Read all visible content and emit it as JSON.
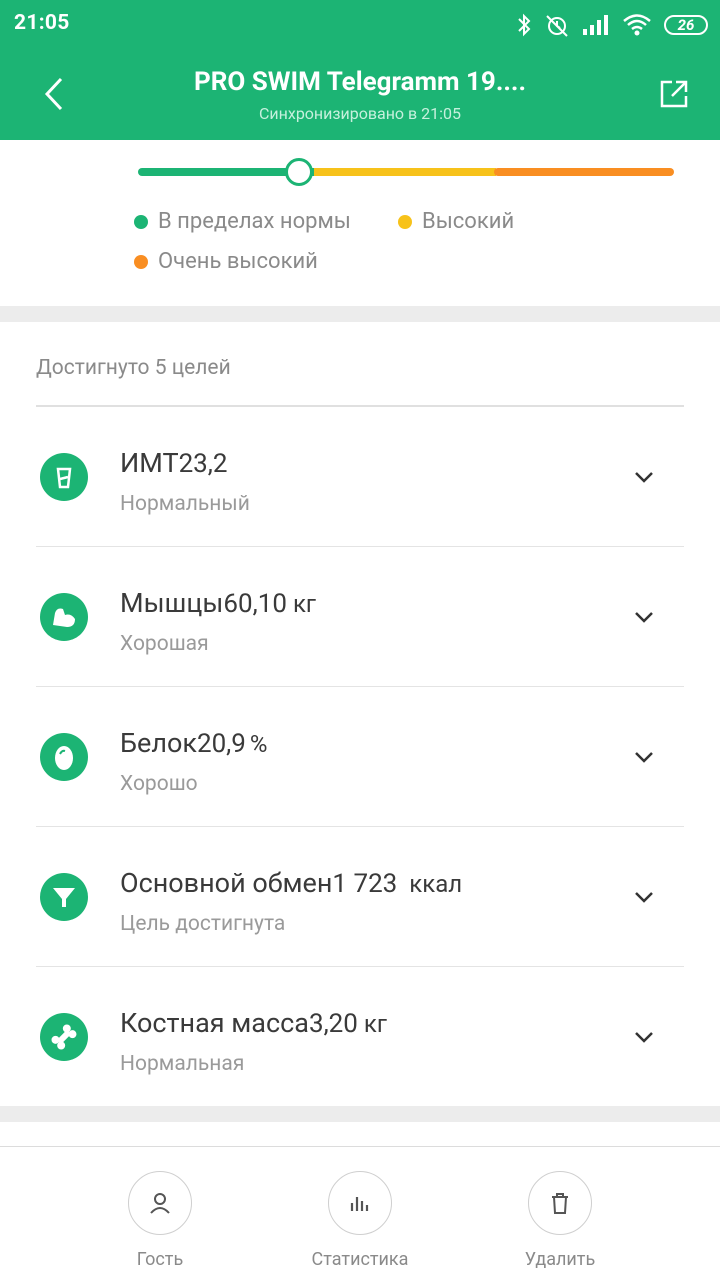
{
  "status_bar": {
    "time": "21:05",
    "battery": "26"
  },
  "header": {
    "title": "PRO SWIM Telegramm 19....",
    "subtitle": "Синхронизировано в 21:05"
  },
  "scale": {
    "position_fraction": 0.3,
    "colors": {
      "normal": "#1cb474",
      "high": "#f7c21a",
      "very_high": "#f98e22"
    },
    "legend": {
      "normal": "В пределах нормы",
      "high": "Высокий",
      "very_high": "Очень высокий"
    }
  },
  "goals": {
    "title": "Достигнуто 5 целей",
    "items": [
      {
        "name": "ИМТ",
        "value": "23,2",
        "unit": "",
        "status": "Нормальный",
        "icon": "bmi-icon"
      },
      {
        "name": "Мышцы",
        "value": "60,10",
        "unit": "кг",
        "status": "Хорошая",
        "icon": "muscle-icon"
      },
      {
        "name": "Белок",
        "value": "20,9",
        "unit": "%",
        "status": "Хорошо",
        "icon": "protein-egg-icon"
      },
      {
        "name": "Основной обмен",
        "value": "1 723",
        "unit": "ккал",
        "status": "Цель достигнута",
        "icon": "metabolism-funnel-icon"
      },
      {
        "name": "Костная масса",
        "value": "3,20",
        "unit": "кг",
        "status": "Нормальная",
        "icon": "bone-icon"
      }
    ]
  },
  "bottom_bar": {
    "guest": "Гость",
    "stats": "Статистика",
    "delete": "Удалить"
  }
}
